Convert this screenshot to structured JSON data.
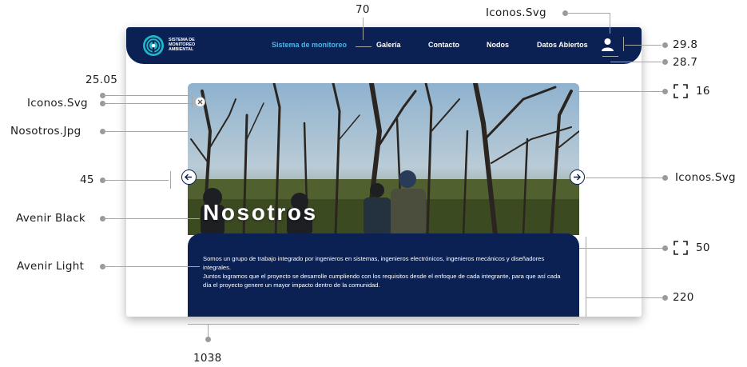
{
  "nav": {
    "logo": {
      "line1": "SISTEMA DE",
      "line2": "MONITOREO",
      "line3": "AMBIENTAL"
    },
    "items": [
      "Sistema de monitoreo",
      "Galería",
      "Contacto",
      "Nodos",
      "Datos Abiertos"
    ],
    "active_index": 0,
    "user_icon": "user-icon"
  },
  "hero": {
    "title": "Nosotros",
    "paragraph_1": "Somos un grupo de trabajo integrado por ingenieros en sistemas, ingenieros electrónicos, ingenieros mecánicos y diseñadores integrales.",
    "paragraph_2": "Juntos logramos que el proyecto se desarrolle cumpliendo con los requisitos desde el enfoque de cada integrante, para que así cada día el proyecto genere un mayor impacto dentro de la comunidad.",
    "close_icon": "close-icon",
    "prev_icon": "arrow-left-icon",
    "next_icon": "arrow-right-icon"
  },
  "annotations": {
    "spacing_top": "70",
    "icons_top": "Iconos.Svg",
    "height_nav": "29.8",
    "width_icon": "28.7",
    "close_size": "25.05",
    "icons_close": "Iconos.Svg",
    "photo": "Nosotros.Jpg",
    "radius_photo": "16",
    "arrow_size": "45",
    "icons_arrow": "Iconos.Svg",
    "font_title": "Avenir Black",
    "radius_panel": "50",
    "font_body": "Avenir Light",
    "panel_height": "220",
    "total_width": "1038"
  },
  "colors": {
    "navy": "#0b2154",
    "accent": "#4fb4e8",
    "white": "#ffffff"
  }
}
